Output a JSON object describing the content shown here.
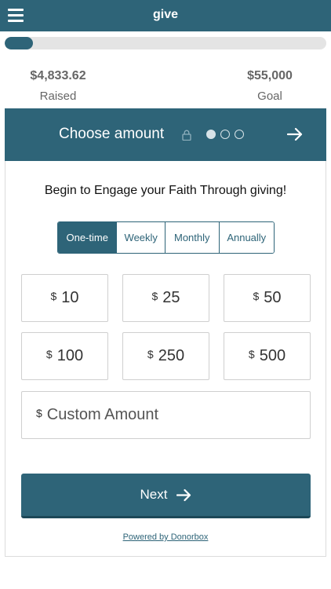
{
  "header": {
    "title": "give",
    "menu_icon": "hamburger-menu-icon"
  },
  "campaign": {
    "progress_fraction": 0.088,
    "raised_value": "$4,833.62",
    "raised_label": "Raised",
    "goal_value": "$55,000",
    "goal_label": "Goal"
  },
  "step": {
    "title": "Choose amount",
    "lock_icon": "lock-icon",
    "total_steps": 3,
    "current_step": 1,
    "next_icon": "arrow-right-icon"
  },
  "form": {
    "prompt": "Begin to Engage your Faith Through giving!",
    "frequencies": [
      "One-time",
      "Weekly",
      "Monthly",
      "Annually"
    ],
    "selected_frequency": "One-time",
    "currency_symbol": "$",
    "amounts": [
      "10",
      "25",
      "50",
      "100",
      "250",
      "500"
    ],
    "custom_placeholder": "Custom Amount",
    "next_label": "Next",
    "powered_by": "Powered by Donorbox"
  },
  "colors": {
    "primary": "#2e6478",
    "track": "#e4e4e4"
  }
}
